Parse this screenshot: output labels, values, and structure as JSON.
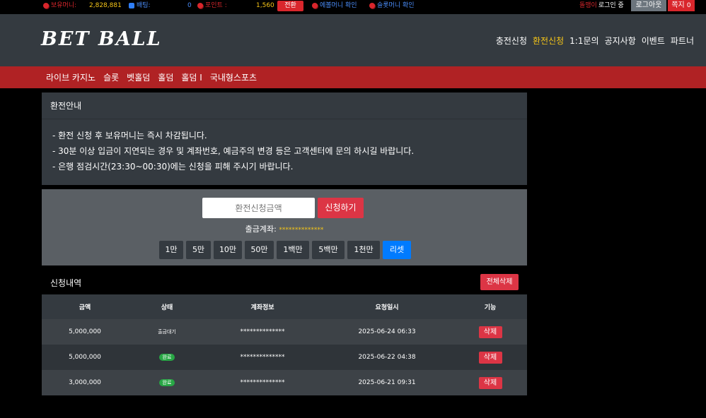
{
  "topbar": {
    "balance_label": "보유머니:",
    "balance_value": "2,828,881",
    "bet_label": "배팅:",
    "bet_value": "0",
    "point_label": "포인트 :",
    "point_value": "1,560",
    "convert_label": "전환",
    "bonus_check": "에볼머니 확인",
    "slot_check": "슬롯머니 확인",
    "username": "돌맹이",
    "login_status": "로그인 중",
    "logout_label": "로그아웃",
    "message_label": "쪽지",
    "message_count": "0"
  },
  "header": {
    "logo": "BET BALL",
    "nav": [
      "충전신청",
      "환전신청",
      "1:1문의",
      "공지사항",
      "이벤트",
      "파트너"
    ],
    "active_nav": "환전신청"
  },
  "categories": [
    "라이브 카지노",
    "슬롯",
    "벳홀덤",
    "홀덤",
    "홀덤 I",
    "국내형스포츠"
  ],
  "info": {
    "title": "환전안내",
    "lines": [
      "- 환전 신청 후 보유머니는 즉시 차감됩니다.",
      "- 30분 이상 입금이 지연되는 경우 및 계좌번호, 예금주의 변경 등은 고객센터에 문의 하시길 바랍니다.",
      "- 은행 점검시간(23:30~00:30)에는 신청을 피해 주시기 바랍니다."
    ]
  },
  "form": {
    "amount_placeholder": "환전신청금액",
    "apply_label": "신청하기",
    "account_label": "출금계좌:",
    "account_value": "**************",
    "amount_buttons": [
      "1만",
      "5만",
      "10만",
      "50만",
      "1백만",
      "5백만",
      "1천만"
    ],
    "reset_label": "리셋"
  },
  "history": {
    "title": "신청내역",
    "delete_all_label": "전체삭제",
    "columns": [
      "금액",
      "상태",
      "계좌정보",
      "요청일시",
      "기능"
    ],
    "rows": [
      {
        "amount": "5,000,000",
        "status": "출금대기",
        "account": "**************",
        "date": "2025-06-24 06:33",
        "action": "삭제"
      },
      {
        "amount": "5,000,000",
        "status": "완료",
        "account": "**************",
        "date": "2025-06-22 04:38",
        "action": "삭제"
      },
      {
        "amount": "3,000,000",
        "status": "완료",
        "account": "**************",
        "date": "2025-06-21 09:31",
        "action": "삭제"
      }
    ]
  },
  "colors": {
    "brand_red": "#b02224",
    "accent_yellow": "#f5c518",
    "danger": "#dc3545",
    "primary": "#007bff",
    "success": "#28a745"
  }
}
